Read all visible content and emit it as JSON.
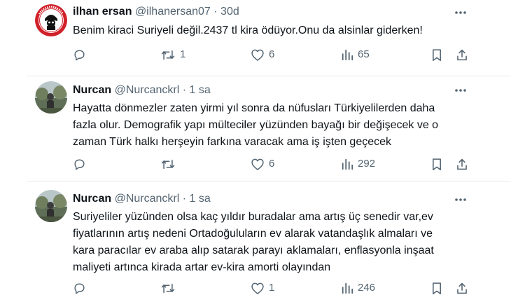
{
  "tweets": [
    {
      "name": "ilhan ersan",
      "handle": "@ilhanersan07",
      "dot": "·",
      "time": "30d",
      "text": "Benim kiraci Suriyeli değil.2437 tl kira ödüyor.Onu da alsinlar giderken!",
      "lines": [
        "Benim kiraci Suriyeli değil.2437 tl kira ödüyor.Onu da alsinlar giderken!"
      ],
      "avatar_icon": "logo-avatar-icon",
      "metrics": {
        "replies": "",
        "retweets": "1",
        "likes": "6",
        "views": "65"
      }
    },
    {
      "name": "Nurcan",
      "handle": "@Nurcanckrl",
      "dot": "·",
      "time": "1 sa",
      "lines": [
        "Hayatta dönmezler zaten yirmi yıl sonra da nüfusları Türkiyelilerden daha",
        "fazla olur. Demografik yapı mülteciler yüzünden bayağı bir değişecek ve o",
        "zaman Türk halkı herşeyin farkına varacak ama iş işten geçecek"
      ],
      "avatar_icon": "photo-avatar-icon",
      "metrics": {
        "replies": "",
        "retweets": "",
        "likes": "6",
        "views": "292"
      }
    },
    {
      "name": "Nurcan",
      "handle": "@Nurcanckrl",
      "dot": "·",
      "time": "1 sa",
      "lines": [
        "Suriyeliler yüzünden olsa kaç yıldır buradalar ama artış üç senedir var,ev",
        "fiyatlarının artış nedeni Ortadoğuluların ev alarak vatandaşlık almaları ve",
        "kara paracılar ev araba alıp satarak parayı aklamaları, enflasyonla inşaat",
        "maliyeti artınca kirada artar ev-kira amorti olayından"
      ],
      "avatar_icon": "photo-avatar-icon",
      "metrics": {
        "replies": "",
        "retweets": "",
        "likes": "1",
        "views": "246"
      }
    }
  ],
  "colors": {
    "text": "#0f1419",
    "muted": "#536471",
    "divider": "#e6e8ea",
    "logo_red": "#d0202a"
  }
}
